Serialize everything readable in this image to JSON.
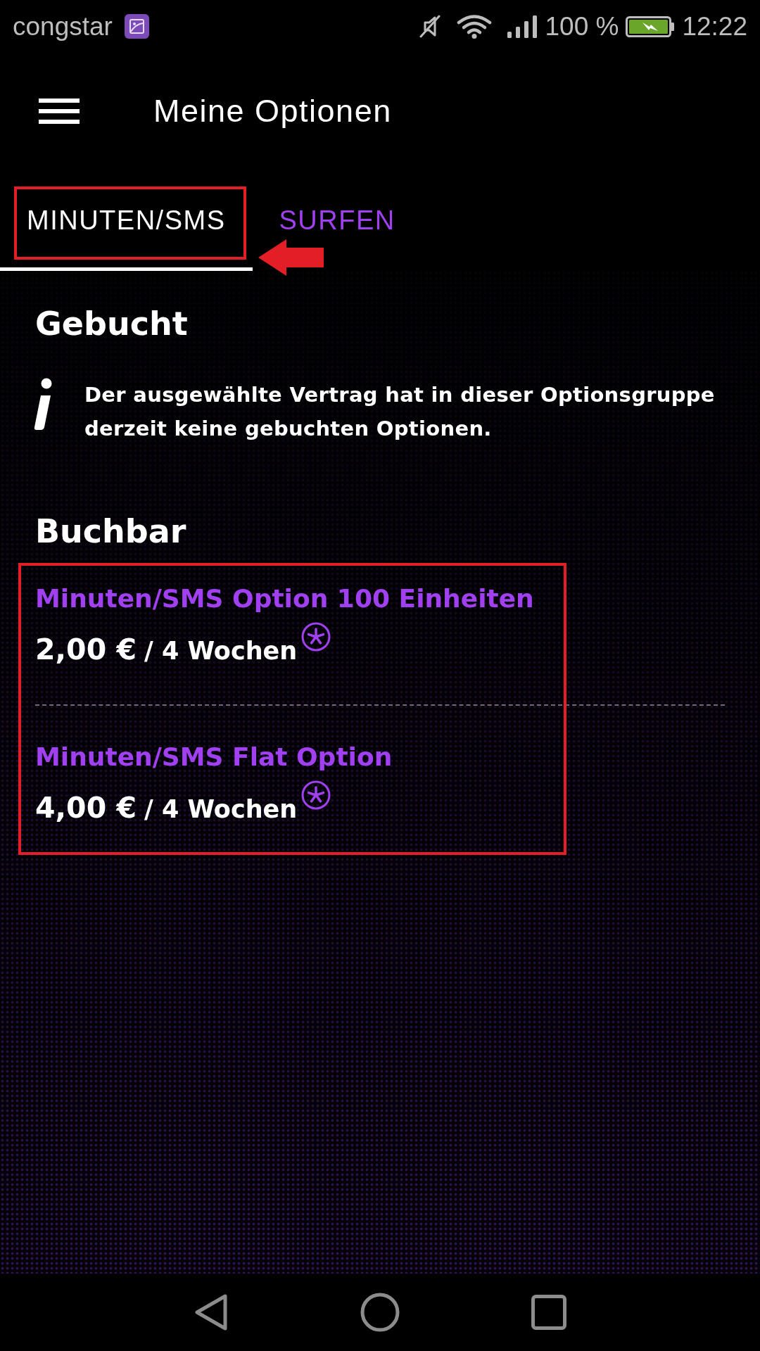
{
  "status_bar": {
    "carrier": "congstar",
    "battery": "100 %",
    "time": "12:22"
  },
  "header": {
    "title": "Meine Optionen"
  },
  "tabs": [
    {
      "label": "MINUTEN/SMS",
      "selected": true
    },
    {
      "label": "SURFEN",
      "selected": false
    }
  ],
  "sections": [
    {
      "kind": "info",
      "title": "Gebucht",
      "message": "Der ausgewählte Vertrag hat in dieser Optionsgruppe derzeit keine gebuchten Optionen."
    },
    {
      "kind": "list",
      "title": "Buchbar",
      "options": [
        {
          "name": "Minuten/SMS Option 100 Einheiten",
          "price": "2,00 €",
          "period": "/ 4 Wochen"
        },
        {
          "name": "Minuten/SMS Flat Option",
          "price": "4,00 €",
          "period": "/ 4 Wochen"
        }
      ]
    }
  ]
}
